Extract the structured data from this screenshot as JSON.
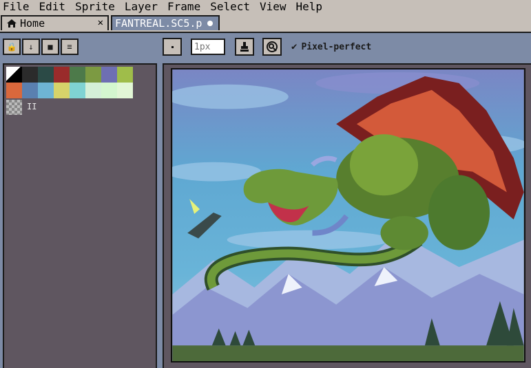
{
  "menu": [
    "File",
    "Edit",
    "Sprite",
    "Layer",
    "Frame",
    "Select",
    "View",
    "Help"
  ],
  "tabs": {
    "home": {
      "label": "Home",
      "icon": "home-icon",
      "close": "✕"
    },
    "file": {
      "label": "FANTREAL.SC5.p"
    }
  },
  "left_toolbar": [
    {
      "name": "lock-button",
      "icon": "lock-icon",
      "glyph": "🔒"
    },
    {
      "name": "down-arrow-button",
      "icon": "down-arrow-icon",
      "glyph": "↓"
    },
    {
      "name": "stop-button",
      "icon": "square-icon",
      "glyph": "■"
    },
    {
      "name": "menu-button",
      "icon": "menu-icon",
      "glyph": "≡"
    }
  ],
  "context_bar": {
    "brush_shape_icon": "dot-icon",
    "brush_size_placeholder": "1px",
    "ink_icon": "ink-stamp-icon",
    "pressure_icon": "pressure-icon",
    "pixel_perfect_checked": true,
    "pixel_perfect_label": "Pixel-perfect"
  },
  "palette": {
    "colors": [
      "#000000",
      "#2b2b2b",
      "#2b4a46",
      "#9a2b2b",
      "#4d7a4a",
      "#7c9a42",
      "#6e6fb3",
      "#9fbd4a",
      "#d9683c",
      "#5a80b0",
      "#6eb4d4",
      "#d6d36a",
      "#7fd3d3",
      "#d4f0d8",
      "#d4f7cf",
      "#e2f7d6"
    ],
    "current_label": "II"
  }
}
